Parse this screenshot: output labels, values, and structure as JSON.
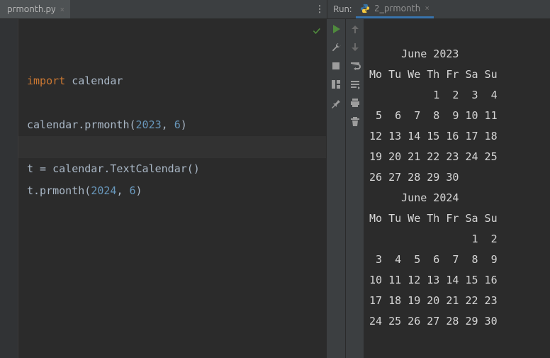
{
  "tabs": {
    "file": "prmonth.py",
    "run_label": "Run:",
    "run_tab": "2_prmonth"
  },
  "code": {
    "l1_kw": "import",
    "l1_mod": " calendar",
    "l3_a": "calendar.prmonth(",
    "l3_n1": "2023",
    "l3_c": ", ",
    "l3_n2": "6",
    "l3_b": ")",
    "l5_a": "t = calendar.TextCalendar()",
    "l6_a": "t.prmonth(",
    "l6_n1": "2024",
    "l6_c": ", ",
    "l6_n2": "6",
    "l6_b": ")"
  },
  "console": {
    "cal1": {
      "title": "     June 2023",
      "head": "Mo Tu We Th Fr Sa Su",
      "w1": "          1  2  3  4",
      "w2": " 5  6  7  8  9 10 11",
      "w3": "12 13 14 15 16 17 18",
      "w4": "19 20 21 22 23 24 25",
      "w5": "26 27 28 29 30"
    },
    "cal2": {
      "title": "     June 2024",
      "head": "Mo Tu We Th Fr Sa Su",
      "w1": "                1  2",
      "w2": " 3  4  5  6  7  8  9",
      "w3": "10 11 12 13 14 15 16",
      "w4": "17 18 19 20 21 22 23",
      "w5": "24 25 26 27 28 29 30"
    }
  }
}
